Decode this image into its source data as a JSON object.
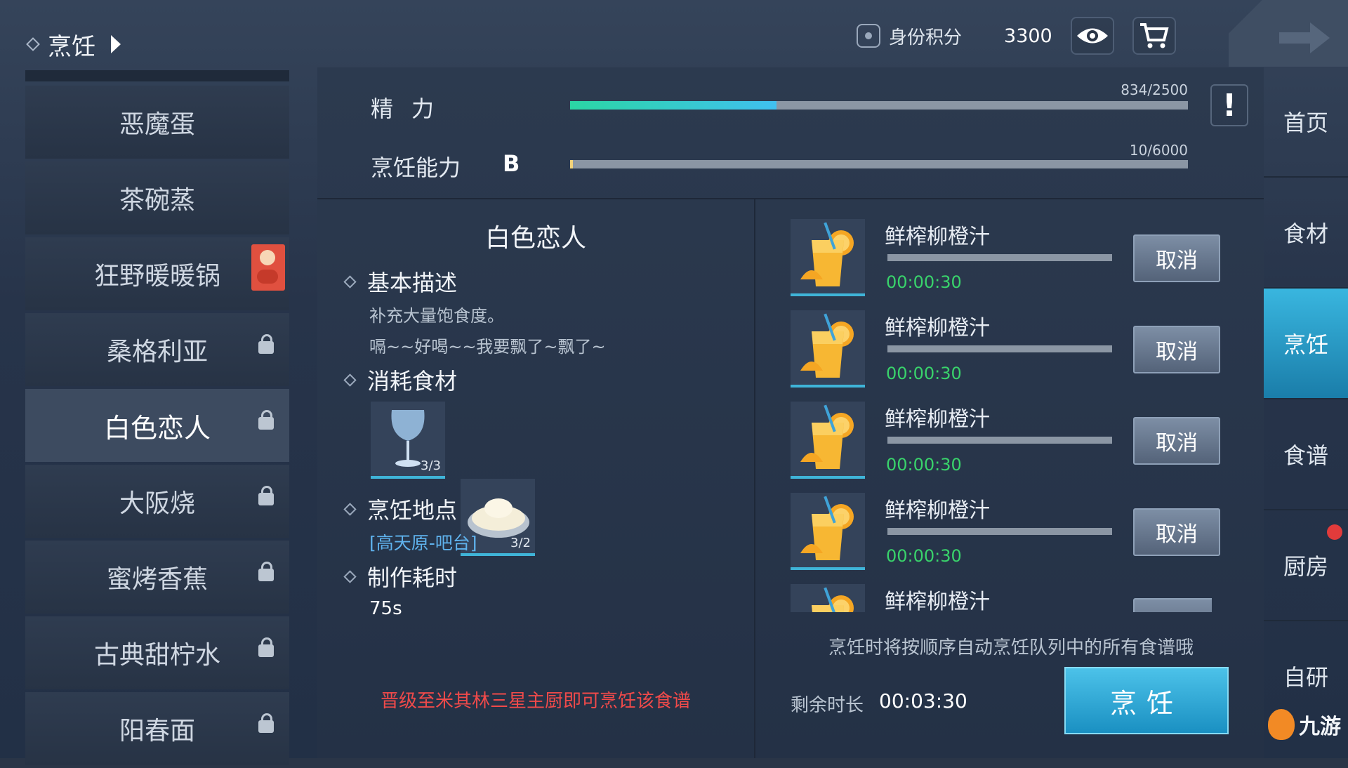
{
  "header": {
    "breadcrumb": "烹饪",
    "id_points_label": "身份积分",
    "id_points_value": "3300"
  },
  "stats": {
    "energy_label": "精力",
    "energy_value": "834/2500",
    "energy_fraction": 0.334,
    "cooking_label": "烹饪能力",
    "cooking_grade": "B",
    "cooking_value": "10/6000",
    "cooking_fraction": 0.0017
  },
  "recipes": [
    {
      "name": "恶魔蛋",
      "locked": false,
      "badge": false
    },
    {
      "name": "茶碗蒸",
      "locked": false,
      "badge": false
    },
    {
      "name": "狂野暖暖锅",
      "locked": false,
      "badge": true
    },
    {
      "name": "桑格利亚",
      "locked": true,
      "badge": false
    },
    {
      "name": "白色恋人",
      "locked": true,
      "badge": false,
      "selected": true
    },
    {
      "name": "大阪烧",
      "locked": true,
      "badge": false
    },
    {
      "name": "蜜烤香蕉",
      "locked": true,
      "badge": false
    },
    {
      "name": "古典甜柠水",
      "locked": true,
      "badge": false
    },
    {
      "name": "阳春面",
      "locked": true,
      "badge": false
    }
  ],
  "detail": {
    "title": "白色恋人",
    "basic_desc_label": "基本描述",
    "desc_line1": "补充大量饱食度。",
    "desc_line2": "嗝~~好喝~~我要飘了~飘了~",
    "ingredients_label": "消耗食材",
    "ingredients": [
      {
        "icon": "wine-glass-icon",
        "count": "3/3"
      },
      {
        "icon": "cream-bowl-icon",
        "count": "3/2"
      }
    ],
    "location_label": "烹饪地点",
    "location": "[高天原-吧台]",
    "time_label": "制作耗时",
    "time": "75s",
    "requirement": "晋级至米其林三星主厨即可烹饪该食谱"
  },
  "queue": {
    "items": [
      {
        "name": "鲜榨柳橙汁",
        "time": "00:00:30",
        "button": "取消"
      },
      {
        "name": "鲜榨柳橙汁",
        "time": "00:00:30",
        "button": "取消"
      },
      {
        "name": "鲜榨柳橙汁",
        "time": "00:00:30",
        "button": "取消"
      },
      {
        "name": "鲜榨柳橙汁",
        "time": "00:00:30",
        "button": "取消"
      },
      {
        "name": "鲜榨柳橙汁"
      }
    ],
    "note": "烹饪时将按顺序自动烹饪队列中的所有食谱哦",
    "remaining_label": "剩余时长",
    "remaining_value": "00:03:30",
    "cook_button": "烹饪"
  },
  "nav": [
    {
      "label": "首页"
    },
    {
      "label": "食材"
    },
    {
      "label": "烹饪",
      "selected": true
    },
    {
      "label": "食谱"
    },
    {
      "label": "厨房",
      "dot": true
    },
    {
      "label": "自研"
    }
  ],
  "watermark": "九游",
  "colors": {
    "energy_start": "#2bd6a4",
    "energy_end": "#40c0f0",
    "timer_green": "#39d36b",
    "warning_red": "#f04a4a",
    "accent_blue": "#2aa3d6"
  }
}
